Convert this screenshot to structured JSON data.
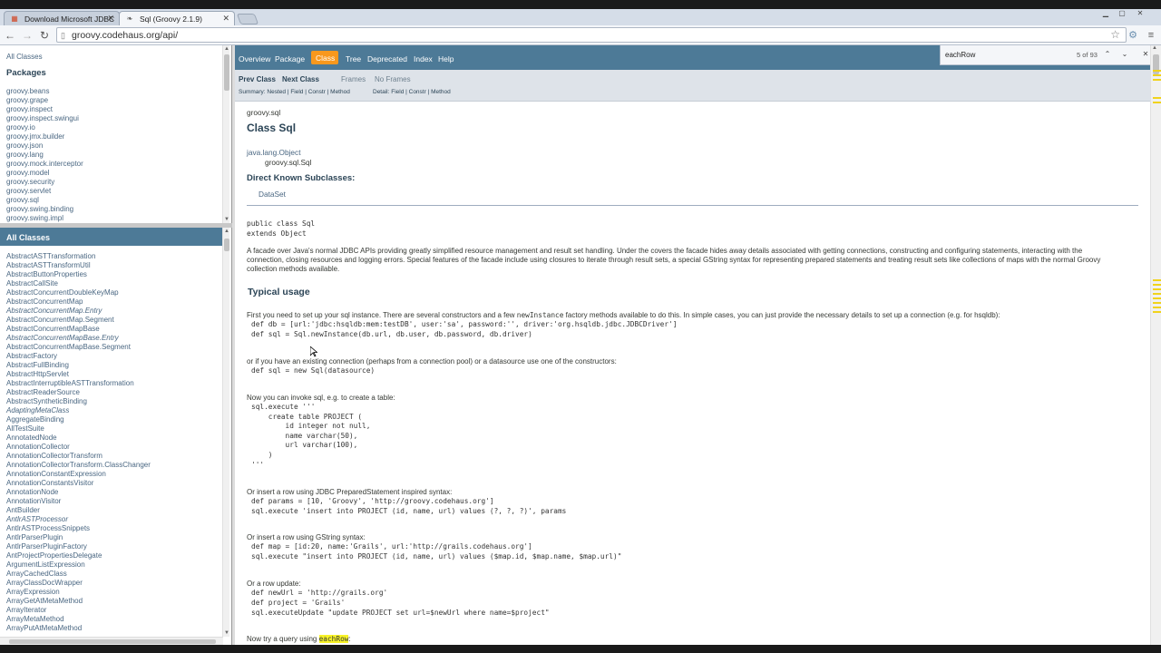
{
  "browser": {
    "tabs": [
      {
        "title": "Download Microsoft JDBC",
        "active": false
      },
      {
        "title": "Sql (Groovy 2.1.9)",
        "active": true
      }
    ],
    "url": "groovy.codehaus.org/api/"
  },
  "find": {
    "query": "eachRow",
    "count": "5 of 93"
  },
  "packages_frame": {
    "all_classes_link": "All Classes",
    "heading": "Packages",
    "items": [
      "groovy.beans",
      "groovy.grape",
      "groovy.inspect",
      "groovy.inspect.swingui",
      "groovy.io",
      "groovy.jmx.builder",
      "groovy.json",
      "groovy.lang",
      "groovy.mock.interceptor",
      "groovy.model",
      "groovy.security",
      "groovy.servlet",
      "groovy.sql",
      "groovy.swing.binding",
      "groovy.swing.impl"
    ]
  },
  "classes_frame": {
    "heading": "All Classes",
    "items": [
      {
        "name": "AbstractASTTransformation",
        "italic": false
      },
      {
        "name": "AbstractASTTransformUtil",
        "italic": false
      },
      {
        "name": "AbstractButtonProperties",
        "italic": false
      },
      {
        "name": "AbstractCallSite",
        "italic": false
      },
      {
        "name": "AbstractConcurrentDoubleKeyMap",
        "italic": false
      },
      {
        "name": "AbstractConcurrentMap",
        "italic": false
      },
      {
        "name": "AbstractConcurrentMap.Entry",
        "italic": true
      },
      {
        "name": "AbstractConcurrentMap.Segment",
        "italic": false
      },
      {
        "name": "AbstractConcurrentMapBase",
        "italic": false
      },
      {
        "name": "AbstractConcurrentMapBase.Entry",
        "italic": true
      },
      {
        "name": "AbstractConcurrentMapBase.Segment",
        "italic": false
      },
      {
        "name": "AbstractFactory",
        "italic": false
      },
      {
        "name": "AbstractFullBinding",
        "italic": false
      },
      {
        "name": "AbstractHttpServlet",
        "italic": false
      },
      {
        "name": "AbstractInterruptibleASTTransformation",
        "italic": false
      },
      {
        "name": "AbstractReaderSource",
        "italic": false
      },
      {
        "name": "AbstractSyntheticBinding",
        "italic": false
      },
      {
        "name": "AdaptingMetaClass",
        "italic": true
      },
      {
        "name": "AggregateBinding",
        "italic": false
      },
      {
        "name": "AllTestSuite",
        "italic": false
      },
      {
        "name": "AnnotatedNode",
        "italic": false
      },
      {
        "name": "AnnotationCollector",
        "italic": false
      },
      {
        "name": "AnnotationCollectorTransform",
        "italic": false
      },
      {
        "name": "AnnotationCollectorTransform.ClassChanger",
        "italic": false
      },
      {
        "name": "AnnotationConstantExpression",
        "italic": false
      },
      {
        "name": "AnnotationConstantsVisitor",
        "italic": false
      },
      {
        "name": "AnnotationNode",
        "italic": false
      },
      {
        "name": "AnnotationVisitor",
        "italic": false
      },
      {
        "name": "AntBuilder",
        "italic": false
      },
      {
        "name": "AntlrASTProcessor",
        "italic": true
      },
      {
        "name": "AntlrASTProcessSnippets",
        "italic": false
      },
      {
        "name": "AntlrParserPlugin",
        "italic": false
      },
      {
        "name": "AntlrParserPluginFactory",
        "italic": false
      },
      {
        "name": "AntProjectPropertiesDelegate",
        "italic": false
      },
      {
        "name": "ArgumentListExpression",
        "italic": false
      },
      {
        "name": "ArrayCachedClass",
        "italic": false
      },
      {
        "name": "ArrayClassDocWrapper",
        "italic": false
      },
      {
        "name": "ArrayExpression",
        "italic": false
      },
      {
        "name": "ArrayGetAtMetaMethod",
        "italic": false
      },
      {
        "name": "ArrayIterator",
        "italic": false
      },
      {
        "name": "ArrayMetaMethod",
        "italic": false
      },
      {
        "name": "ArrayPutAtMetaMethod",
        "italic": false
      }
    ]
  },
  "topnav": {
    "overview": "Overview",
    "package": "Package",
    "class": "Class",
    "tree": "Tree",
    "deprecated": "Deprecated",
    "index": "Index",
    "help": "Help"
  },
  "subnav": {
    "prev_class": "Prev Class",
    "next_class": "Next Class",
    "frames": "Frames",
    "no_frames": "No Frames",
    "summary": "Summary: Nested | Field | Constr | Method",
    "detail": "Detail: Field | Constr | Method"
  },
  "content": {
    "package_name": "groovy.sql",
    "class_title": "Class Sql",
    "hierarchy_parent": "java.lang.Object",
    "hierarchy_child": "groovy.sql.Sql",
    "subclasses_heading": "Direct Known Subclasses:",
    "subclasses": "DataSet",
    "decl_line1": "public class Sql",
    "decl_line2": "extends Object",
    "description_line1": "A facade over Java's normal JDBC APIs providing greatly simplified resource management and result set handling. Under the covers the facade hides away details associated with getting connections, constructing and configuring statements, interacting with the",
    "description_line2": "connection, closing resources and logging errors. Special features of the facade include using closures to iterate through result sets, a special GString syntax for representing prepared statements and treating result sets like collections of maps with the normal Groovy",
    "description_line3": "collection methods available.",
    "typical_usage": "Typical usage",
    "p1_pre": "First you need to set up your sql instance. There are several constructors and a few ",
    "p1_code": "newInstance",
    "p1_post": " factory methods available to do this. In simple cases, you can just provide the necessary details to set up a connection (e.g. for hsqldb):",
    "code1": [
      "def db = [url:'jdbc:hsqldb:mem:testDB', user:'sa', password:'', driver:'org.hsqldb.jdbc.JDBCDriver']",
      "def sql = Sql.newInstance(db.url, db.user, db.password, db.driver)"
    ],
    "p2": "or if you have an existing connection (perhaps from a connection pool) or a datasource use one of the constructors:",
    "code2": [
      "def sql = new Sql(datasource)"
    ],
    "p3": "Now you can invoke sql, e.g. to create a table:",
    "code3": [
      "sql.execute '''",
      "    create table PROJECT (",
      "        id integer not null,",
      "        name varchar(50),",
      "        url varchar(100),",
      "    )",
      "'''"
    ],
    "p4": "Or insert a row using JDBC PreparedStatement inspired syntax:",
    "code4": [
      "def params = [10, 'Groovy', 'http://groovy.codehaus.org']",
      "sql.execute 'insert into PROJECT (id, name, url) values (?, ?, ?)', params"
    ],
    "p5": "Or insert a row using GString syntax:",
    "code5": [
      "def map = [id:20, name:'Grails', url:'http://grails.codehaus.org']",
      "sql.execute \"insert into PROJECT (id, name, url) values ($map.id, $map.name, $map.url)\""
    ],
    "p6": "Or a row update:",
    "code6": [
      "def newUrl = 'http://grails.org'",
      "def project = 'Grails'",
      "sql.executeUpdate \"update PROJECT set url=$newUrl where name=$project\""
    ],
    "p7_pre": "Now try a query using ",
    "p7_hl": "eachRow",
    "p7_post": ":"
  },
  "colors": {
    "nav_bar": "#4d7a97",
    "nav_active": "#f8981d",
    "subnav_bg": "#dee3e9",
    "find_highlight": "#f8f328"
  }
}
